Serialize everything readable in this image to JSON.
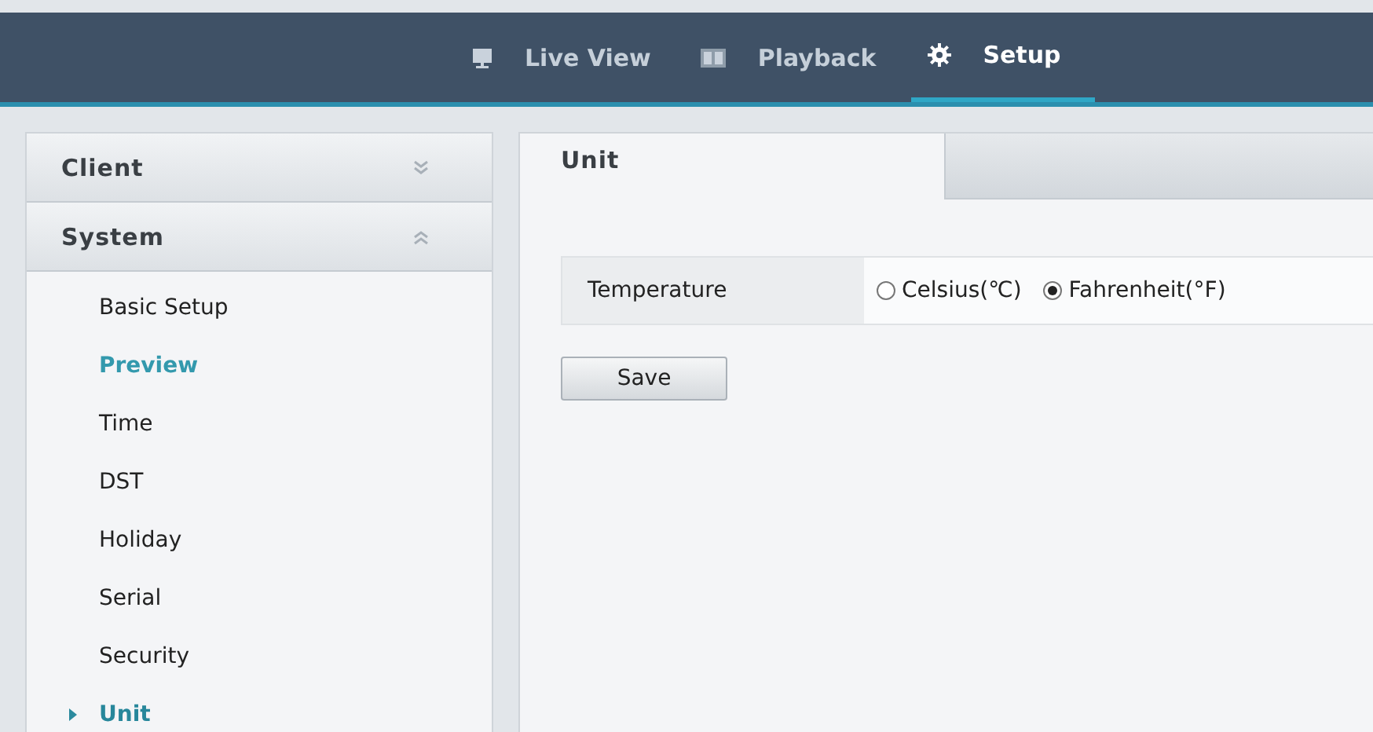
{
  "nav": [
    {
      "label": "Live View",
      "selected": false
    },
    {
      "label": "Playback",
      "selected": false
    },
    {
      "label": "Setup",
      "selected": true
    }
  ],
  "sidebar": {
    "sections": [
      {
        "label": "Client",
        "expanded": false
      },
      {
        "label": "System",
        "expanded": true,
        "items": [
          {
            "label": "Basic Setup",
            "selected": false,
            "hovered": false
          },
          {
            "label": "Preview",
            "selected": false,
            "hovered": true
          },
          {
            "label": "Time",
            "selected": false,
            "hovered": false
          },
          {
            "label": "DST",
            "selected": false,
            "hovered": false
          },
          {
            "label": "Holiday",
            "selected": false,
            "hovered": false
          },
          {
            "label": "Serial",
            "selected": false,
            "hovered": false
          },
          {
            "label": "Security",
            "selected": false,
            "hovered": false
          },
          {
            "label": "Unit",
            "selected": true,
            "hovered": false
          }
        ]
      }
    ]
  },
  "content": {
    "tabs": [
      {
        "label": "Unit",
        "selected": true
      }
    ],
    "fields": [
      {
        "label": "Temperature",
        "options": [
          {
            "label": "Celsius(℃)",
            "selected": false
          },
          {
            "label": "Fahrenheit(°F)",
            "selected": true
          }
        ]
      }
    ],
    "buttons": [
      "Save"
    ]
  }
}
